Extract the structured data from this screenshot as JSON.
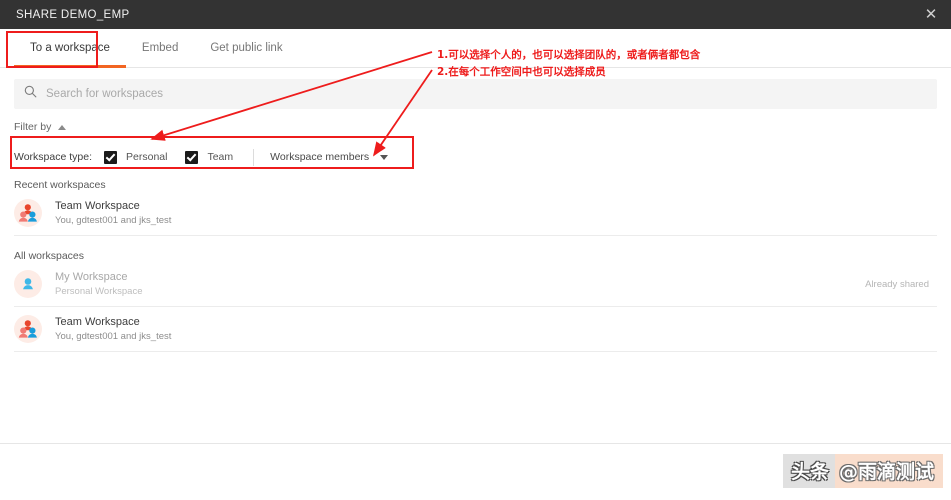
{
  "window": {
    "title": "SHARE DEMO_EMP",
    "close_label": "✕",
    "close_icon": "close-icon"
  },
  "tabs": [
    {
      "label": "To a workspace",
      "active": true
    },
    {
      "label": "Embed",
      "active": false
    },
    {
      "label": "Get public link",
      "active": false
    }
  ],
  "search": {
    "placeholder": "Search for workspaces",
    "value": "",
    "icon": "search-icon"
  },
  "filter": {
    "toggle_label": "Filter by",
    "toggle_icon": "caret-up-icon",
    "type_label": "Workspace type:",
    "checkboxes": [
      {
        "label": "Personal",
        "checked": true
      },
      {
        "label": "Team",
        "checked": true
      }
    ],
    "members_dropdown": {
      "label": "Workspace members",
      "icon": "caret-down-icon"
    }
  },
  "sections": [
    {
      "title": "Recent workspaces",
      "rows": [
        {
          "name": "Team Workspace",
          "sub": "You, gdtest001 and jks_test",
          "avatar": "team-avatar-icon",
          "status": "",
          "dim": false
        }
      ]
    },
    {
      "title": "All workspaces",
      "rows": [
        {
          "name": "My Workspace",
          "sub": "Personal Workspace",
          "avatar": "personal-avatar-icon",
          "status": "Already shared",
          "dim": true
        },
        {
          "name": "Team Workspace",
          "sub": "You, gdtest001 and jks_test",
          "avatar": "team-avatar-icon",
          "status": "",
          "dim": false
        }
      ]
    }
  ],
  "annotations": {
    "color": "#ee1c1c",
    "note_line1": "1.可以选择个人的，也可以选择团队的，或者俩者都包含",
    "note_line2": "2.在每个工作空间中也可以选择成员"
  },
  "watermark": {
    "brand": "头条",
    "handle": "@雨滴测试"
  },
  "colors": {
    "titlebar_bg": "#333333",
    "active_tab_underline": "#f26522",
    "annotation_red": "#ee1c1c",
    "avatar_bg": "#fdece6",
    "search_bg": "#f4f4f4"
  }
}
